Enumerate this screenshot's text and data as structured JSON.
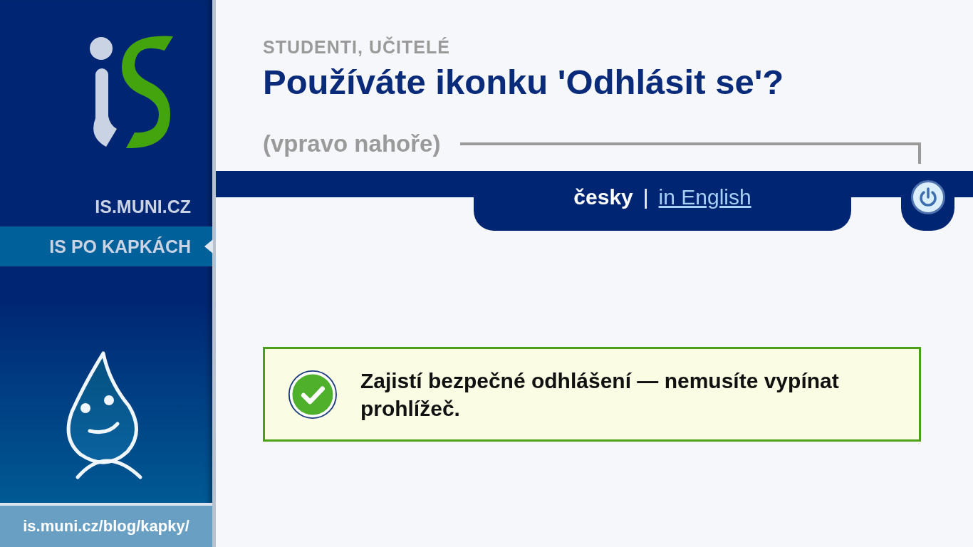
{
  "sidebar": {
    "items": [
      {
        "label": "IS.MUNI.CZ",
        "selected": false
      },
      {
        "label": "IS PO KAPKÁCH",
        "selected": true
      }
    ],
    "footer_link": "is.muni.cz/blog/kapky/"
  },
  "header": {
    "kicker": "STUDENTI, UČITELÉ",
    "title": "Používáte ikonku 'Odhlásit se'?",
    "hint": "(vpravo nahoře)"
  },
  "languages": [
    {
      "label": "česky",
      "selected": true
    },
    {
      "label": "in English",
      "selected": false
    }
  ],
  "language_separator": "|",
  "notice": {
    "kind": "success",
    "text": "Zajistí bezpečné odhlášení — nemusíte vypínat prohlížeč."
  }
}
